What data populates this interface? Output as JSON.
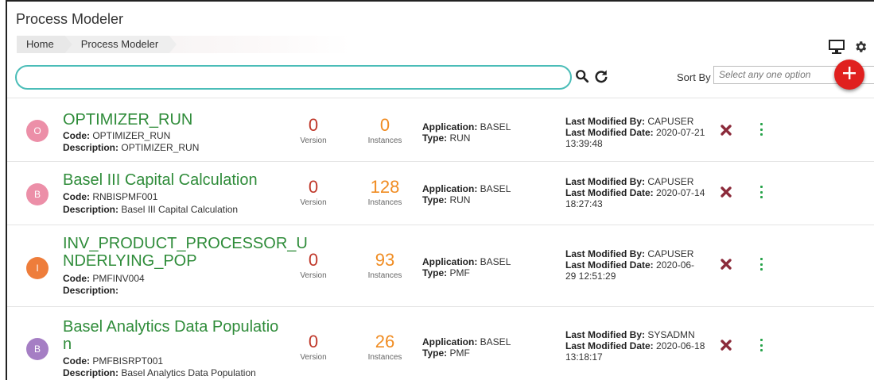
{
  "header": {
    "title": "Process Modeler",
    "breadcrumb": [
      {
        "label": "Home"
      },
      {
        "label": "Process Modeler"
      }
    ]
  },
  "toolbar": {
    "search_value": "",
    "sort_label": "Sort By",
    "sort_placeholder": "Select any one option",
    "icons": [
      "monitor-icon",
      "gear-icon",
      "search-icon",
      "refresh-icon",
      "add-icon"
    ]
  },
  "labels": {
    "version": "Version",
    "instances": "Instances",
    "code": "Code:",
    "description": "Description:",
    "application": "Application:",
    "type": "Type:",
    "last_modified_by": "Last Modified By:",
    "last_modified_date": "Last Modified Date:"
  },
  "colors": {
    "accent_teal": "#4bbdb8",
    "name_green": "#2f8c3a",
    "version_red": "#c0392b",
    "instances_orange": "#f08c22",
    "fab_red": "#e0201f",
    "kebab_green": "#27a34a"
  },
  "processes": [
    {
      "initial": "O",
      "avatar_color": "#ec8fa8",
      "name_lines": [
        "OPTIMIZER_RUN"
      ],
      "code": "OPTIMIZER_RUN",
      "description": "OPTIMIZER_RUN",
      "version": "0",
      "instances": "0",
      "application": "BASEL",
      "type": "RUN",
      "modified_by": "CAPUSER",
      "modified_date_l1": "2020-07-21",
      "modified_date_l2": "13:39:48"
    },
    {
      "initial": "B",
      "avatar_color": "#ec8fa8",
      "name_lines": [
        "Basel III Capital Calculation"
      ],
      "code": "RNBISPMF001",
      "description": "Basel III Capital Calculation",
      "version": "0",
      "instances": "128",
      "application": "BASEL",
      "type": "RUN",
      "modified_by": "CAPUSER",
      "modified_date_l1": "2020-07-14",
      "modified_date_l2": "18:27:43"
    },
    {
      "initial": "I",
      "avatar_color": "#ee7d3b",
      "name_lines": [
        "INV_PRODUCT_PROCESSOR_U",
        "NDERLYING_POP"
      ],
      "code": "PMFINV004",
      "description": "",
      "version": "0",
      "instances": "93",
      "application": "BASEL",
      "type": "PMF",
      "modified_by": "CAPUSER",
      "modified_date_l1": "2020-06-",
      "modified_date_l2": "29 12:51:29"
    },
    {
      "initial": "B",
      "avatar_color": "#a57ec4",
      "name_lines": [
        "Basel Analytics Data Populatio",
        "n"
      ],
      "code": "PMFBISRPT001",
      "description": "Basel Analytics Data Population",
      "version": "0",
      "instances": "26",
      "application": "BASEL",
      "type": "PMF",
      "modified_by": "SYSADMN",
      "modified_date_l1": "2020-06-18",
      "modified_date_l2": "13:18:17"
    }
  ]
}
